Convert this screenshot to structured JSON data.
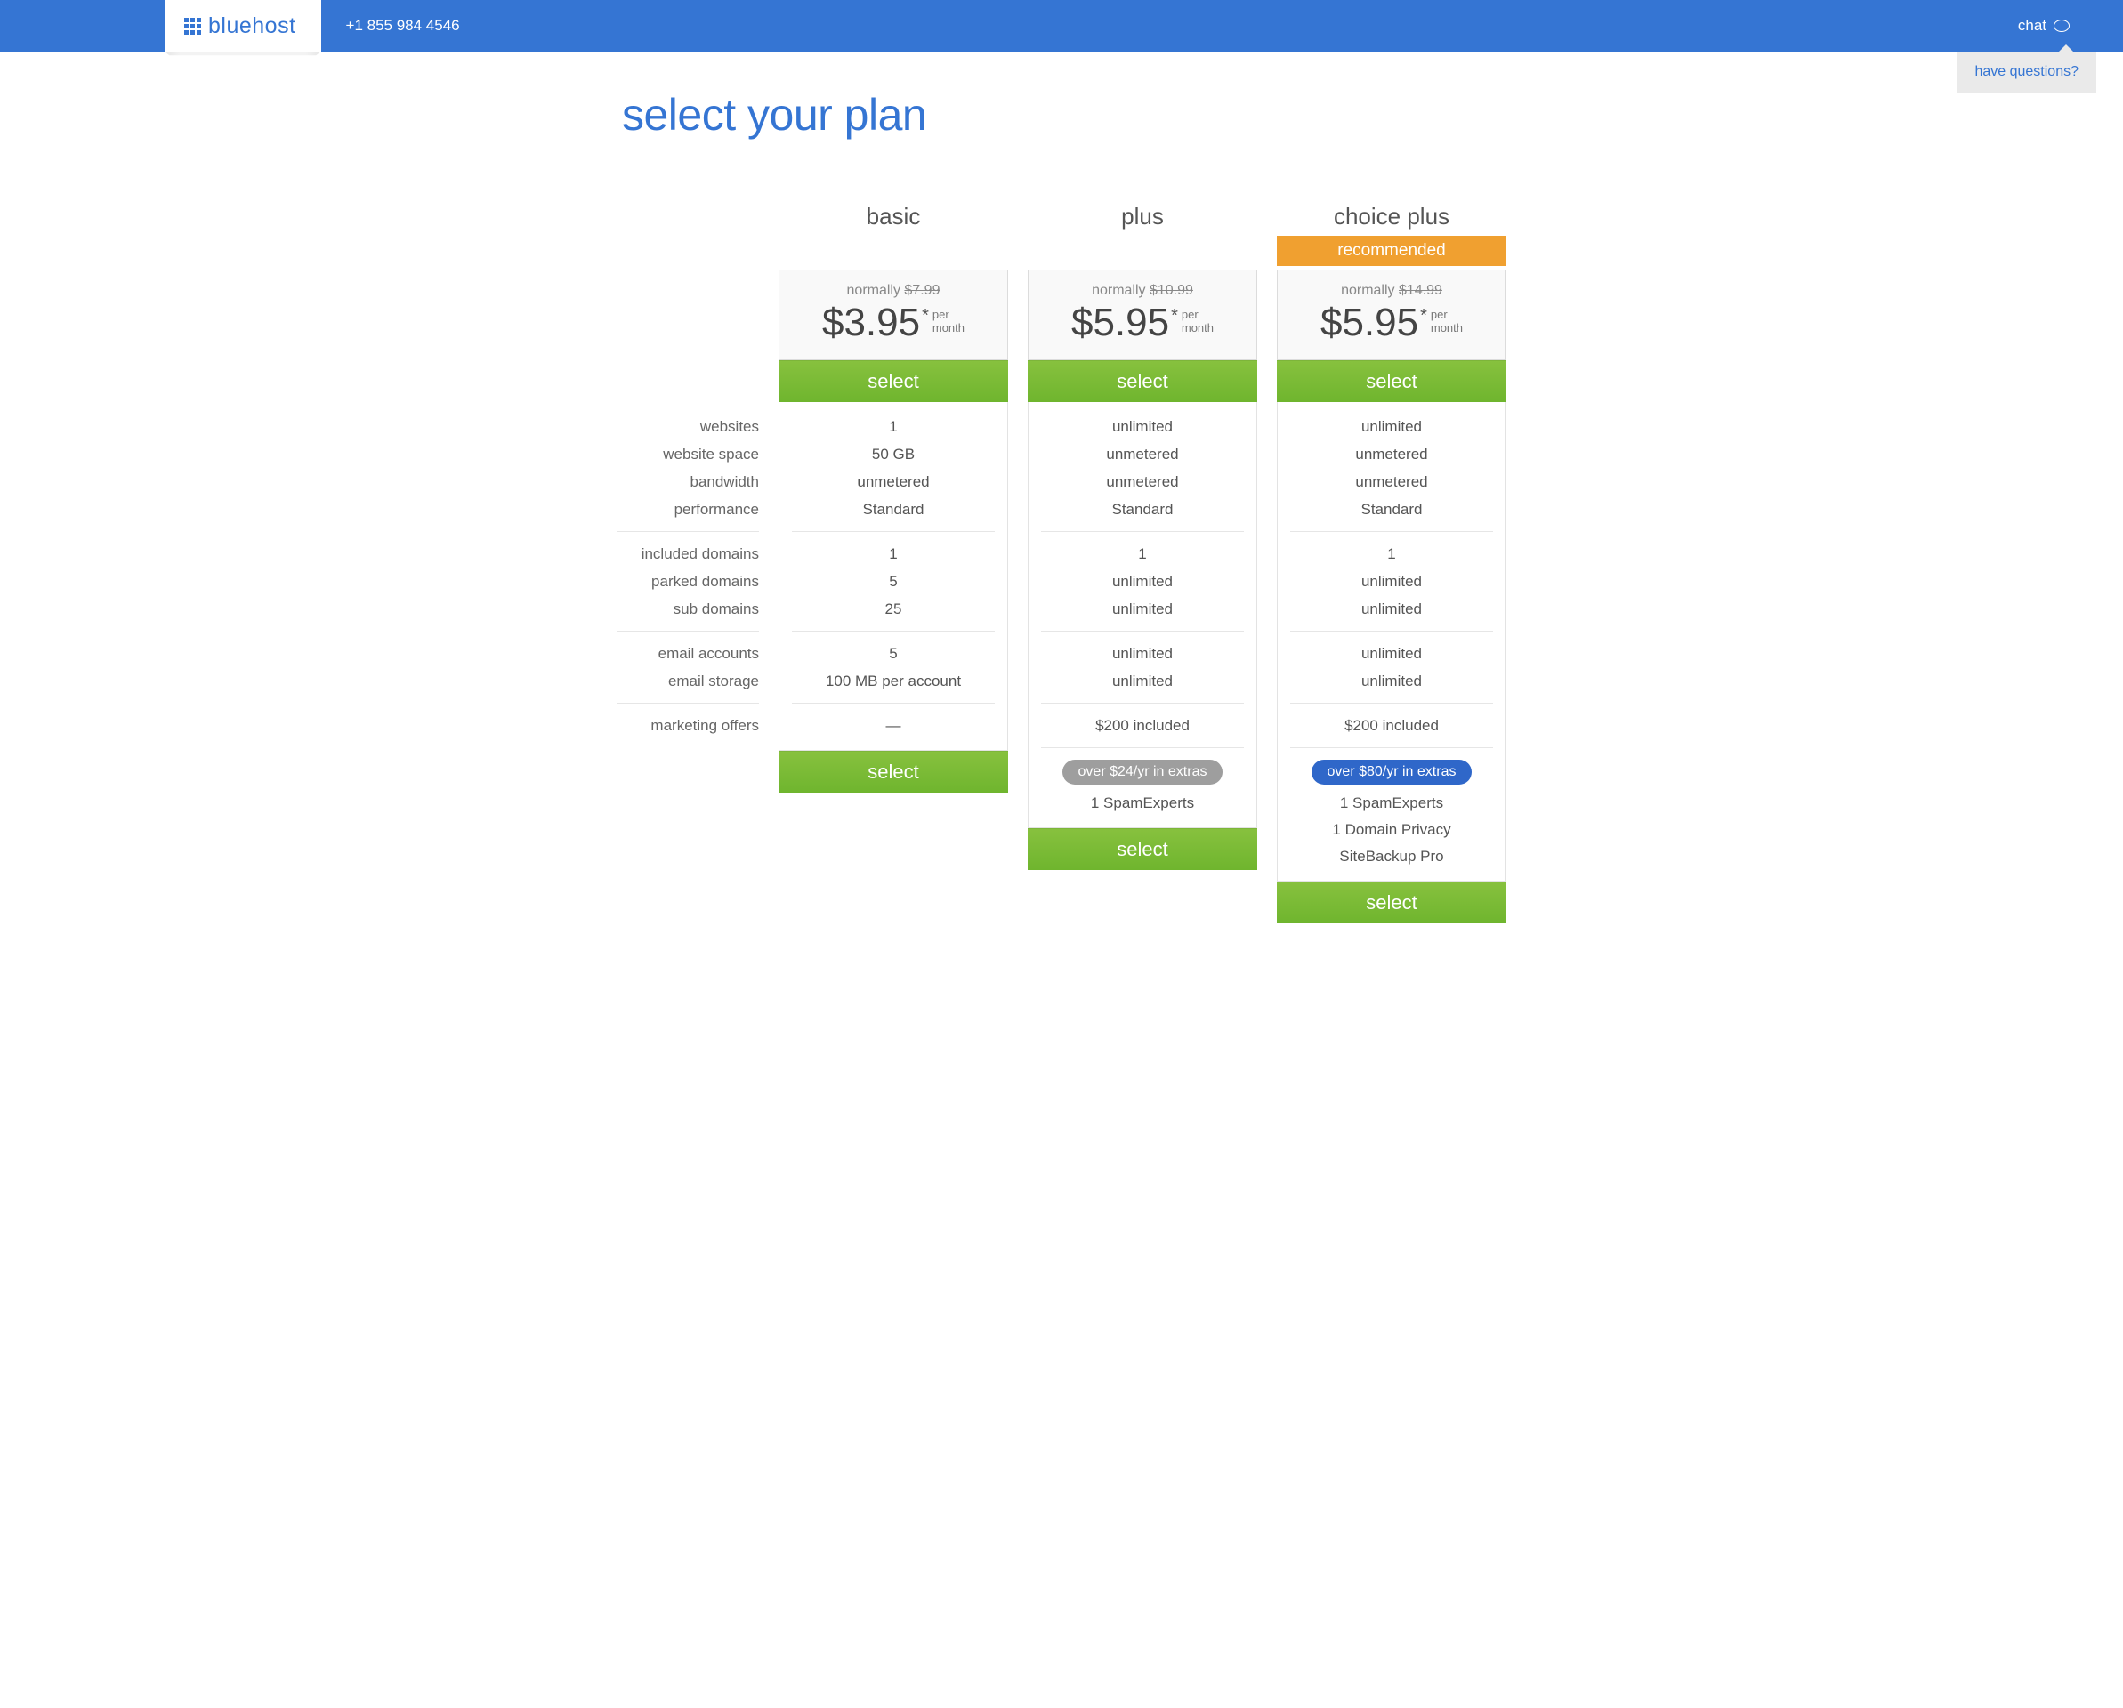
{
  "header": {
    "brand": "bluehost",
    "phone": "+1 855 984 4546",
    "chat": "chat",
    "questions": "have questions?"
  },
  "heading": "select your plan",
  "select_label": "select",
  "normally_prefix": "normally ",
  "per_month_line1": "per",
  "per_month_line2": "month",
  "labels": {
    "g1": [
      "websites",
      "website space",
      "bandwidth",
      "performance"
    ],
    "g2": [
      "included domains",
      "parked domains",
      "sub domains"
    ],
    "g3": [
      "email accounts",
      "email storage"
    ],
    "g4": [
      "marketing offers"
    ]
  },
  "plans": [
    {
      "name": "basic",
      "normal": "$7.99",
      "price": "$3.95",
      "g1": [
        "1",
        "50 GB",
        "unmetered",
        "Standard"
      ],
      "g2": [
        "1",
        "5",
        "25"
      ],
      "g3": [
        "5",
        "100 MB per account"
      ],
      "g4": [
        "—"
      ],
      "extras_pill": "",
      "extras": []
    },
    {
      "name": "plus",
      "normal": "$10.99",
      "price": "$5.95",
      "g1": [
        "unlimited",
        "unmetered",
        "unmetered",
        "Standard"
      ],
      "g2": [
        "1",
        "unlimited",
        "unlimited"
      ],
      "g3": [
        "unlimited",
        "unlimited"
      ],
      "g4": [
        "$200 included"
      ],
      "extras_pill": "over $24/yr in extras",
      "extras": [
        "1 SpamExperts"
      ]
    },
    {
      "name": "choice plus",
      "recommended": "recommended",
      "normal": "$14.99",
      "price": "$5.95",
      "g1": [
        "unlimited",
        "unmetered",
        "unmetered",
        "Standard"
      ],
      "g2": [
        "1",
        "unlimited",
        "unlimited"
      ],
      "g3": [
        "unlimited",
        "unlimited"
      ],
      "g4": [
        "$200 included"
      ],
      "extras_pill": "over $80/yr in extras",
      "extras": [
        "1 SpamExperts",
        "1 Domain Privacy",
        "SiteBackup Pro"
      ]
    }
  ]
}
